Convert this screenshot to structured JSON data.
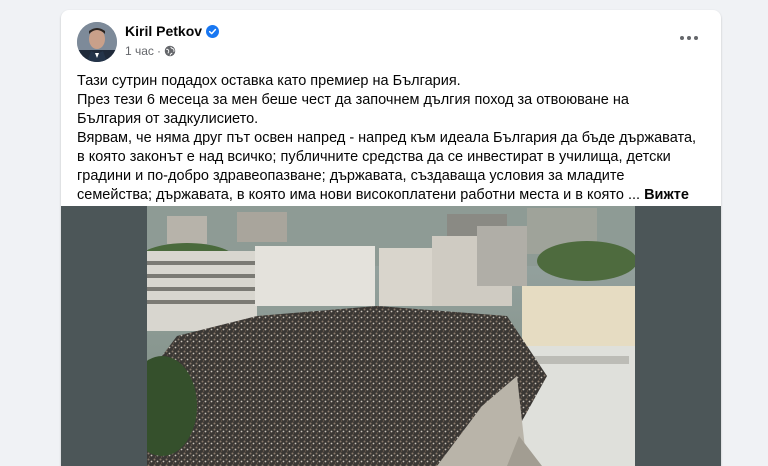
{
  "post": {
    "author": "Kiril Petkov",
    "time": "1 час",
    "separator": "·",
    "paragraphs": [
      "Тази сутрин подадох оставка като премиер на България.",
      "През тези 6 месеца за мен беше чест да започнем дългия поход за отвоюване на България от задкулисието.",
      "Вярвам, че няма друг път освен напред - напред към идеала България да бъде държавата, в която законът е над всичко; публичните средства да се инвестират в училища, детски градини и по-добро здравеопазване; държавата, създаваща условия за младите семейства; държавата, в която има нови високоплатени работни места и в която ..."
    ],
    "see_more": "Вижте повече"
  },
  "colors": {
    "background": "#f0f2f5",
    "card": "#ffffff",
    "verified": "#1877f2",
    "muted": "#65676b",
    "media_letterbox": "#4c5658"
  },
  "icons": {
    "verified": "verified-badge-icon",
    "audience": "globe-icon",
    "menu": "more-options-icon"
  }
}
